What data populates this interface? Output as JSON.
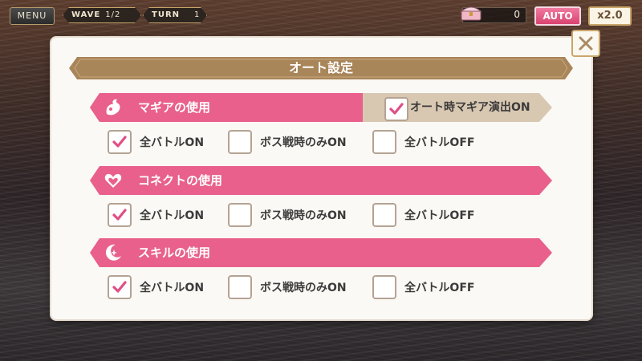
{
  "hud": {
    "menu_label": "MENU",
    "wave_label": "WAVE",
    "wave_value": "1/2",
    "turn_label": "TURN",
    "turn_value": "1",
    "chest_count": "0",
    "auto_label": "AUTO",
    "speed_label": "x2.0"
  },
  "dialog": {
    "title": "オート設定",
    "close_icon": "close-icon",
    "sections": [
      {
        "label": "マギアの使用",
        "icon": "magia-icon",
        "extra_option": {
          "label": "オート時マギア演出ON",
          "checked": true
        },
        "options": [
          {
            "label": "全バトルON",
            "checked": true
          },
          {
            "label": "ボス戦時のみON",
            "checked": false
          },
          {
            "label": "全バトルOFF",
            "checked": false
          }
        ]
      },
      {
        "label": "コネクトの使用",
        "icon": "connect-heart-icon",
        "options": [
          {
            "label": "全バトルON",
            "checked": true
          },
          {
            "label": "ボス戦時のみON",
            "checked": false
          },
          {
            "label": "全バトルOFF",
            "checked": false
          }
        ]
      },
      {
        "label": "スキルの使用",
        "icon": "skill-moon-icon",
        "options": [
          {
            "label": "全バトルON",
            "checked": true
          },
          {
            "label": "ボス戦時のみON",
            "checked": false
          },
          {
            "label": "全バトルOFF",
            "checked": false
          }
        ]
      }
    ]
  },
  "colors": {
    "accent_pink": "#e8608b",
    "banner_gold": "#a9855a",
    "check_pink": "#e04f85",
    "checkbox_border": "#b4a393"
  }
}
